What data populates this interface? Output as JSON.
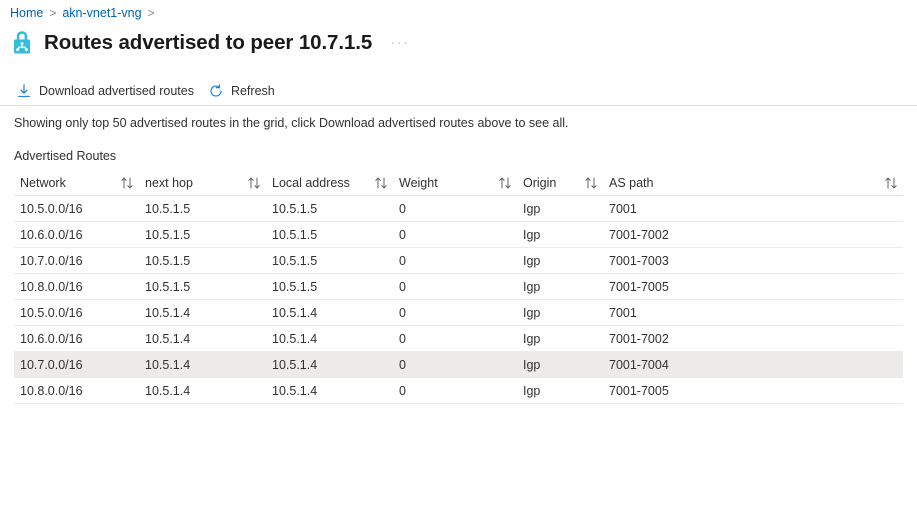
{
  "breadcrumb": {
    "items": [
      {
        "label": "Home"
      },
      {
        "label": "akn-vnet1-vng"
      }
    ],
    "separator": ">"
  },
  "header": {
    "icon": "vpn-gateway-lock-icon",
    "title": "Routes advertised to peer 10.7.1.5",
    "more_label": "···"
  },
  "toolbar": {
    "download_label": "Download advertised routes",
    "download_icon": "download-arrow-icon",
    "refresh_label": "Refresh",
    "refresh_icon": "refresh-circular-arrow-icon"
  },
  "notice": "Showing only top 50 advertised routes in the grid, click Download advertised routes above to see all.",
  "grid": {
    "label": "Advertised Routes",
    "sort_icon": "sort-updown-arrows-icon",
    "columns": [
      {
        "key": "network",
        "label": "Network"
      },
      {
        "key": "next_hop",
        "label": "next hop"
      },
      {
        "key": "local_address",
        "label": "Local address"
      },
      {
        "key": "weight",
        "label": "Weight"
      },
      {
        "key": "origin",
        "label": "Origin"
      },
      {
        "key": "as_path",
        "label": "AS path"
      }
    ],
    "rows": [
      {
        "network": "10.5.0.0/16",
        "next_hop": "10.5.1.5",
        "local_address": "10.5.1.5",
        "weight": "0",
        "origin": "Igp",
        "as_path": "7001",
        "selected": false
      },
      {
        "network": "10.6.0.0/16",
        "next_hop": "10.5.1.5",
        "local_address": "10.5.1.5",
        "weight": "0",
        "origin": "Igp",
        "as_path": "7001-7002",
        "selected": false
      },
      {
        "network": "10.7.0.0/16",
        "next_hop": "10.5.1.5",
        "local_address": "10.5.1.5",
        "weight": "0",
        "origin": "Igp",
        "as_path": "7001-7003",
        "selected": false
      },
      {
        "network": "10.8.0.0/16",
        "next_hop": "10.5.1.5",
        "local_address": "10.5.1.5",
        "weight": "0",
        "origin": "Igp",
        "as_path": "7001-7005",
        "selected": false
      },
      {
        "network": "10.5.0.0/16",
        "next_hop": "10.5.1.4",
        "local_address": "10.5.1.4",
        "weight": "0",
        "origin": "Igp",
        "as_path": "7001",
        "selected": false
      },
      {
        "network": "10.6.0.0/16",
        "next_hop": "10.5.1.4",
        "local_address": "10.5.1.4",
        "weight": "0",
        "origin": "Igp",
        "as_path": "7001-7002",
        "selected": false
      },
      {
        "network": "10.7.0.0/16",
        "next_hop": "10.5.1.4",
        "local_address": "10.5.1.4",
        "weight": "0",
        "origin": "Igp",
        "as_path": "7001-7004",
        "selected": true
      },
      {
        "network": "10.8.0.0/16",
        "next_hop": "10.5.1.4",
        "local_address": "10.5.1.4",
        "weight": "0",
        "origin": "Igp",
        "as_path": "7001-7005",
        "selected": false
      }
    ]
  },
  "colors": {
    "link": "#0063b1",
    "accent": "#0078d4",
    "icon_cyan": "#32bedd",
    "text": "#323130",
    "row_selected": "#edebe9",
    "rule": "#edebe9"
  }
}
